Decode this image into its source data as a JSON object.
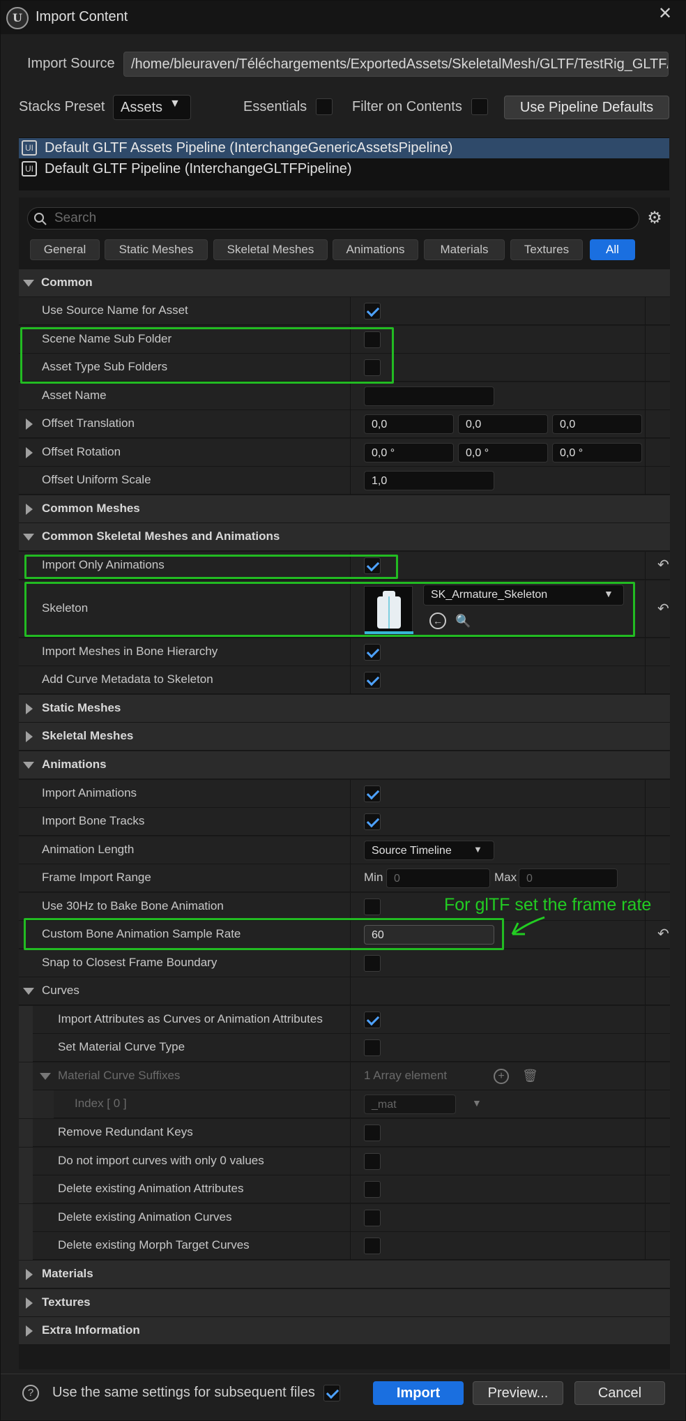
{
  "window": {
    "title": "Import Content",
    "logo": "U"
  },
  "import_source": {
    "label": "Import Source",
    "path": "/home/bleuraven/Téléchargements/ExportedAssets/SkeletalMesh/GLTF/TestRig_GLTF/"
  },
  "stacks": {
    "label": "Stacks Preset",
    "value": "Assets",
    "essentials_label": "Essentials",
    "filter_label": "Filter on Contents",
    "defaults_button": "Use Pipeline Defaults"
  },
  "pipelines": [
    {
      "name": "Default GLTF Assets Pipeline (InterchangeGenericAssetsPipeline)",
      "selected": true
    },
    {
      "name": "Default GLTF Pipeline (InterchangeGLTFPipeline)",
      "selected": false
    }
  ],
  "search": {
    "placeholder": "Search"
  },
  "tabs": [
    "General",
    "Static Meshes",
    "Skeletal Meshes",
    "Animations",
    "Materials",
    "Textures",
    "All"
  ],
  "common": {
    "header": "Common",
    "use_source_name": "Use Source Name for Asset",
    "scene_sub_folder": "Scene Name Sub Folder",
    "asset_type_sub_folders": "Asset Type Sub Folders",
    "asset_name": "Asset Name",
    "offset_translation": {
      "label": "Offset Translation",
      "x": "0,0",
      "y": "0,0",
      "z": "0,0"
    },
    "offset_rotation": {
      "label": "Offset Rotation",
      "x": "0,0 °",
      "y": "0,0 °",
      "z": "0,0 °"
    },
    "offset_scale": {
      "label": "Offset Uniform Scale",
      "value": "1,0"
    }
  },
  "common_meshes": {
    "header": "Common Meshes"
  },
  "common_skel": {
    "header": "Common Skeletal Meshes and Animations",
    "import_only_anims": "Import Only Animations",
    "skeleton_label": "Skeleton",
    "skeleton_value": "SK_Armature_Skeleton",
    "import_meshes_bone": "Import Meshes in Bone Hierarchy",
    "add_curve_metadata": "Add Curve Metadata to Skeleton"
  },
  "static_meshes": {
    "header": "Static Meshes"
  },
  "skeletal_meshes": {
    "header": "Skeletal Meshes"
  },
  "animations": {
    "header": "Animations",
    "import_animations": "Import Animations",
    "import_bone_tracks": "Import Bone Tracks",
    "animation_length": {
      "label": "Animation Length",
      "value": "Source Timeline"
    },
    "frame_range": {
      "label": "Frame Import Range",
      "min_label": "Min",
      "min": "0",
      "max_label": "Max",
      "max": "0"
    },
    "use_30hz": "Use 30Hz to Bake Bone Animation",
    "custom_rate": {
      "label": "Custom Bone Animation Sample Rate",
      "value": "60"
    },
    "snap_frame": "Snap to Closest Frame Boundary"
  },
  "curves": {
    "header": "Curves",
    "import_attributes": "Import Attributes as Curves or Animation Attributes",
    "set_material_curve": "Set Material Curve Type",
    "material_suffixes": {
      "label": "Material Curve Suffixes",
      "value": "1 Array element"
    },
    "index0": {
      "label": "Index [ 0 ]",
      "value": "_mat"
    },
    "remove_redundant": "Remove Redundant Keys",
    "no_zero_curves": "Do not import curves with only 0 values",
    "delete_attrs": "Delete existing Animation Attributes",
    "delete_curves": "Delete existing Animation Curves",
    "delete_morph": "Delete existing Morph Target Curves"
  },
  "materials": {
    "header": "Materials"
  },
  "textures": {
    "header": "Textures"
  },
  "extra": {
    "header": "Extra Information"
  },
  "annotation": "For glTF set the frame rate",
  "footer": {
    "same_settings": "Use the same settings for subsequent files",
    "import": "Import",
    "preview": "Preview...",
    "cancel": "Cancel"
  },
  "colors": {
    "accent": "#1a6fe0",
    "highlight": "#22bb22",
    "check": "#4ea2ff"
  }
}
